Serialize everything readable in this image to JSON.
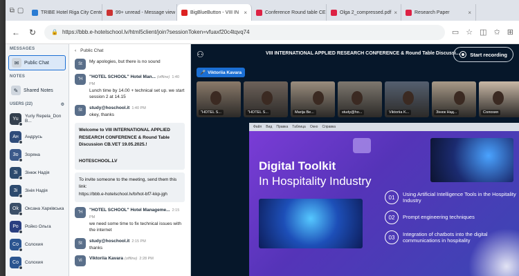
{
  "browser": {
    "tabs": [
      {
        "title": "TRIBE Hotel Riga City Cente",
        "color": "#2b7cd3"
      },
      {
        "title": "99+ unread - Message view",
        "color": "#c33"
      },
      {
        "title": "BigBlueButton - VIII IN",
        "color": "#d22"
      },
      {
        "title": "Conference Round table CE",
        "color": "#d24"
      },
      {
        "title": "Olga 2_compressed.pdf",
        "color": "#d24"
      },
      {
        "title": "Research Paper",
        "color": "#d24"
      }
    ],
    "url": "https://bbb.e-hotelschool.lv/html5client/join?sessionToken=vfuaxf20c4tqvq74"
  },
  "sidebar": {
    "messages_heading": "MESSAGES",
    "public_chat": "Public Chat",
    "notes_heading": "NOTES",
    "shared_notes": "Shared Notes",
    "users_heading": "USERS (22)",
    "users": [
      {
        "initials": "Yu",
        "name": "Yuriy Repela_Don B...",
        "color": "#333f4d"
      },
      {
        "initials": "Ан",
        "name": "Андрусь",
        "color": "#2f4c7a"
      },
      {
        "initials": "Зо",
        "name": "Зоряна",
        "color": "#3c5a8a"
      },
      {
        "initials": "Зі",
        "name": "Зінюк Надія",
        "color": "#2c4a6e"
      },
      {
        "initials": "Зі",
        "name": "Зінія Надія",
        "color": "#2c4a6e"
      },
      {
        "initials": "Ok",
        "name": "Оксана Харківська",
        "color": "#3b4f68"
      },
      {
        "initials": "Ро",
        "name": "Ройко Ольга",
        "color": "#2a3f80"
      },
      {
        "initials": "Со",
        "name": "Солохия",
        "color": "#2b5590"
      },
      {
        "initials": "Со",
        "name": "Солохия",
        "color": "#2b5590"
      }
    ]
  },
  "chat": {
    "back_label": "Public Chat",
    "messages": [
      {
        "initials": "St",
        "name": "",
        "time": "",
        "offline": "",
        "text": "My apologies, but there is no sound"
      },
      {
        "initials": "\"H",
        "name": "\"HOTEL SCHOOL\" Hotel Man...",
        "time": "1:40 PM",
        "offline": "(offline)",
        "text": "Lunch time by 14.00 + technical set up. we start session 2 at 14.15"
      },
      {
        "initials": "St",
        "name": "study@hoschool.it",
        "time": "1:40 PM",
        "offline": "",
        "text": "okey, thanks"
      }
    ],
    "welcome": "Welcome to VIII INTERNATIONAL APPLIED RESEARCH CONFERENCE & Round Table Discussion CB.VET 19.05.2025.!",
    "welcome_link": "HOTESCHOOL.LV",
    "invite": "To invite someone to the meeting, send them this link:",
    "invite_link": "https://bbb.e-hotelschool.lv/b/hot-bf7-kkp-jgh",
    "messages2": [
      {
        "initials": "\"H",
        "name": "\"HOTEL SCHOOL\" Hotel Manageme...",
        "time": "2:15 PM",
        "offline": "",
        "text": "we need some time to fix technical issues with the internet"
      },
      {
        "initials": "St",
        "name": "study@hoschool.it",
        "time": "2:15 PM",
        "offline": "",
        "text": "thanks"
      },
      {
        "initials": "Vi",
        "name": "Viktoriia Kavara",
        "time": "2:28 PM",
        "offline": "(offline)",
        "text": ""
      }
    ]
  },
  "main": {
    "conference_title": "VIII INTERNATIONAL APPLIED RESEARCH CONFERENCE & Round Table Discussi...",
    "record_label": "Start recording",
    "speaker": "Viktoriia Kavara",
    "videos": [
      {
        "label": "\"HOTEL S...",
        "bg": "#8a7a6a"
      },
      {
        "label": "\"HOTEL S...",
        "bg": "#6d625a"
      },
      {
        "label": "Marija Be...",
        "bg": "#9a8d7e"
      },
      {
        "label": "study@ho...",
        "bg": "#7e786f"
      },
      {
        "label": "Viktoriia K...",
        "bg": "#556070"
      },
      {
        "label": "Зінюк Над...",
        "bg": "#a89a88"
      },
      {
        "label": "Солохия",
        "bg": "#c9b8a6"
      }
    ]
  },
  "slide": {
    "title_line1": "Digital Toolkit",
    "title_line2": "In Hospitality Industry",
    "bullets": [
      {
        "num": "01",
        "text": "Using Artificial Intelligence Tools in the Hospitality Industry"
      },
      {
        "num": "02",
        "text": "Prompt engineering techniques"
      },
      {
        "num": "03",
        "text": "Integration of chatbots into the digital communications in hospitality"
      }
    ],
    "chrome_items": [
      "Файл",
      "Вид",
      "Правка",
      "Таблица",
      "Окно",
      "Справка"
    ]
  }
}
